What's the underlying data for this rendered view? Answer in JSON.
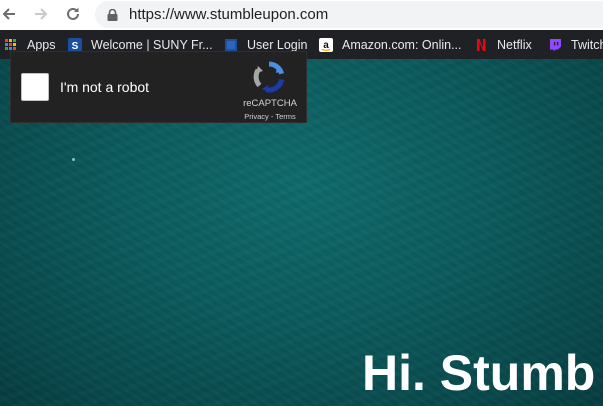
{
  "browser": {
    "url": "https://www.stumbleupon.com",
    "icons": {
      "back": "arrow-left-icon",
      "forward": "arrow-right-icon",
      "reload": "reload-icon",
      "lock": "lock-icon"
    }
  },
  "bookmarks": [
    {
      "label": "Apps",
      "icon": "apps-grid-icon"
    },
    {
      "label": "Welcome | SUNY Fr...",
      "icon": "suny-icon"
    },
    {
      "label": "User Login",
      "icon": "user-login-icon"
    },
    {
      "label": "Amazon.com: Onlin...",
      "icon": "amazon-icon"
    },
    {
      "label": "Netflix",
      "icon": "netflix-icon"
    },
    {
      "label": "Twitch",
      "icon": "twitch-icon"
    }
  ],
  "captcha": {
    "checkbox_label": "I'm not a robot",
    "brand": "reCAPTCHA",
    "privacy": "Privacy",
    "separator": "-",
    "terms": "Terms"
  },
  "hero": {
    "title": "Hi. Stumb"
  },
  "colors": {
    "toolbar_bg": "#ffffff",
    "bookmarks_bg": "#202124",
    "page_bg": "#0b5a5c",
    "captcha_bg": "#222222"
  }
}
